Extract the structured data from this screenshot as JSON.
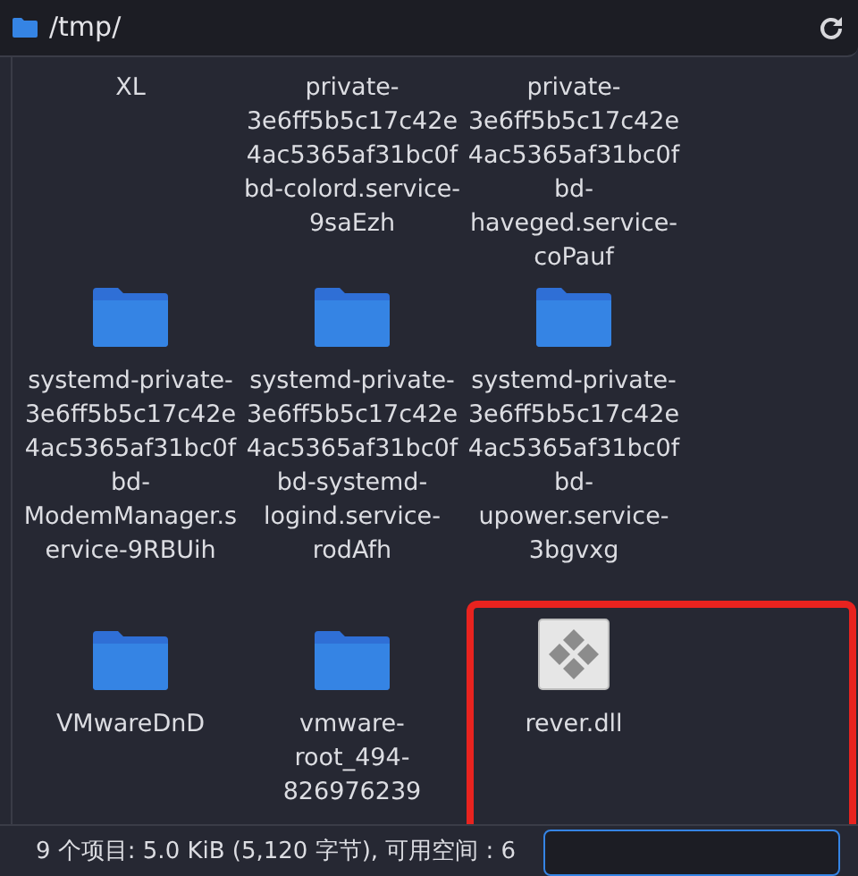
{
  "location_bar": {
    "path": "/tmp/"
  },
  "files": [
    {
      "name": "XL",
      "kind": "cut"
    },
    {
      "name": "private-3e6ff5b5c17c42e4ac5365af31bc0fbd-colord.service-9saEzh",
      "kind": "cut"
    },
    {
      "name": "private-3e6ff5b5c17c42e4ac5365af31bc0fbd-haveged.service-coPauf",
      "kind": "cut"
    },
    {
      "name": "systemd-private-3e6ff5b5c17c42e4ac5365af31bc0fbd-ModemManager.service-9RBUih",
      "kind": "folder"
    },
    {
      "name": "systemd-private-3e6ff5b5c17c42e4ac5365af31bc0fbd-systemd-logind.service-rodAfh",
      "kind": "folder"
    },
    {
      "name": "systemd-private-3e6ff5b5c17c42e4ac5365af31bc0fbd-upower.service-3bgvxg",
      "kind": "folder"
    },
    {
      "name": "VMwareDnD",
      "kind": "folder"
    },
    {
      "name": "vmware-root_494-826976239",
      "kind": "folder"
    },
    {
      "name": "rever.dll",
      "kind": "dll"
    }
  ],
  "status_bar": {
    "text": "9 个项目: 5.0 KiB (5,120 字节), 可用空间 : 6"
  }
}
